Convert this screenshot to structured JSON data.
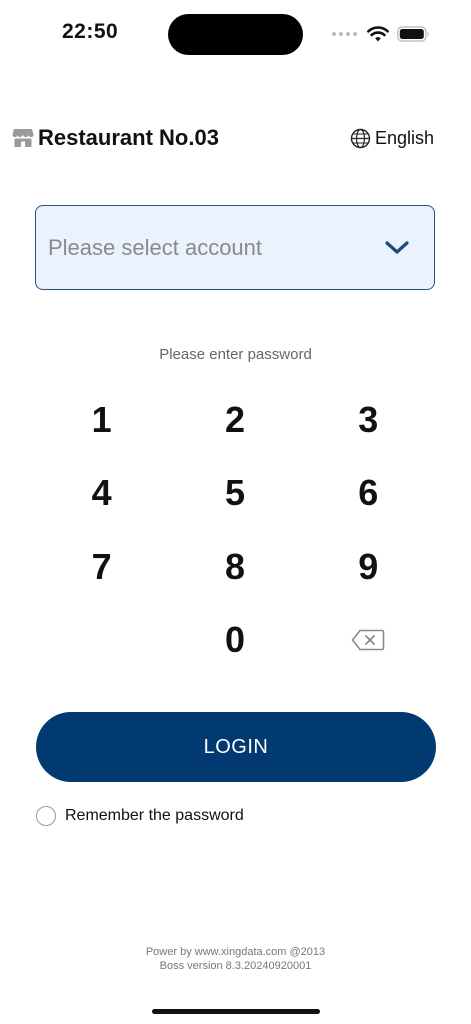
{
  "status_bar": {
    "time": "22:50",
    "icons": [
      "cellular-signal-icon",
      "wifi-icon",
      "battery-icon"
    ]
  },
  "header": {
    "store_icon": "storefront-icon",
    "title": "Restaurant No.03",
    "language_icon": "globe-icon",
    "language": "English"
  },
  "account_select": {
    "placeholder": "Please select account",
    "icon": "chevron-down-icon"
  },
  "password": {
    "prompt": "Please enter password"
  },
  "keypad": {
    "keys": [
      "1",
      "2",
      "3",
      "4",
      "5",
      "6",
      "7",
      "8",
      "9",
      "",
      "0",
      ""
    ],
    "delete_icon": "backspace-icon"
  },
  "login": {
    "label": "LOGIN"
  },
  "remember": {
    "label": "Remember the password",
    "checked": false
  },
  "footer": {
    "powered_by": "Power by www.xingdata.com @2013",
    "version": "Boss version 8.3.20240920001"
  },
  "colors": {
    "primary": "#003a70",
    "select_background": "#eaf2fd",
    "select_border": "#2c4f73",
    "chevron": "#1d4a7a"
  }
}
